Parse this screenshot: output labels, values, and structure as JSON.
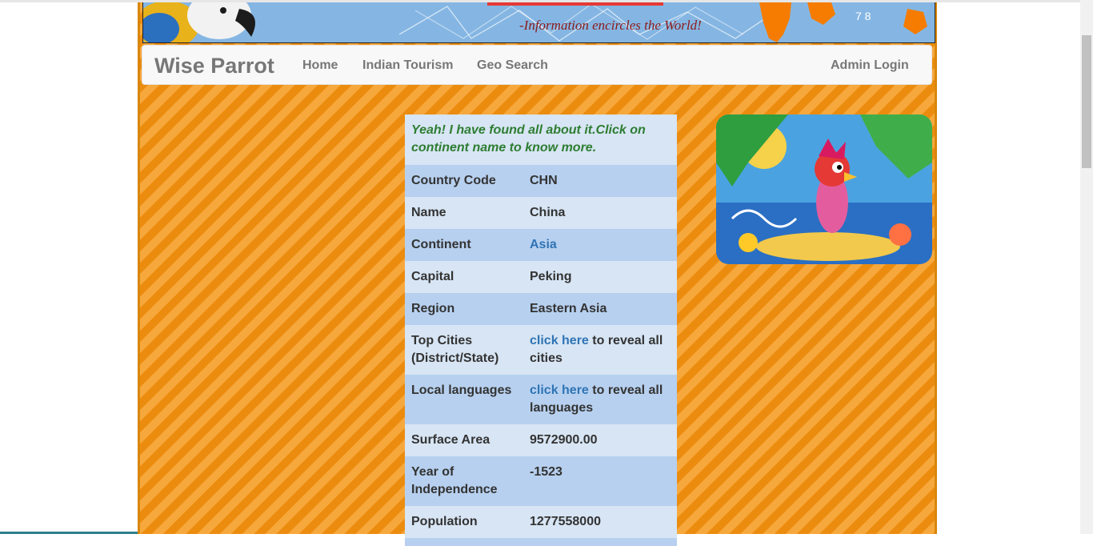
{
  "banner": {
    "tagline": "-Information encircles the World!"
  },
  "navbar": {
    "brand": "Wise Parrot",
    "links": [
      "Home",
      "Indian Tourism",
      "Geo Search"
    ],
    "admin": "Admin Login"
  },
  "info": {
    "message": "Yeah! I have found all about it.Click on continent name to know more.",
    "rows": [
      {
        "label": "Country Code",
        "value": "CHN"
      },
      {
        "label": "Name",
        "value": "China"
      },
      {
        "label": "Continent",
        "value": "Asia"
      },
      {
        "label": "Capital",
        "value": "Peking"
      },
      {
        "label": "Region",
        "value": "Eastern Asia"
      },
      {
        "label": "Top Cities (District/State)",
        "link": "click here",
        "suffix": " to reveal all cities"
      },
      {
        "label": "Local languages",
        "link": "click here",
        "suffix": " to reveal all languages"
      },
      {
        "label": "Surface Area",
        "value": "9572900.00"
      },
      {
        "label": "Year of Independence",
        "value": "-1523"
      },
      {
        "label": "Population",
        "value": "1277558000"
      }
    ]
  },
  "colors": {
    "stripe_light": "#f7a83c",
    "stripe_dark": "#ec8c0f",
    "row_dark": "#b7d0ef",
    "row_light": "#d7e5f4",
    "link": "#2f74b5",
    "message": "#2e7d32"
  }
}
